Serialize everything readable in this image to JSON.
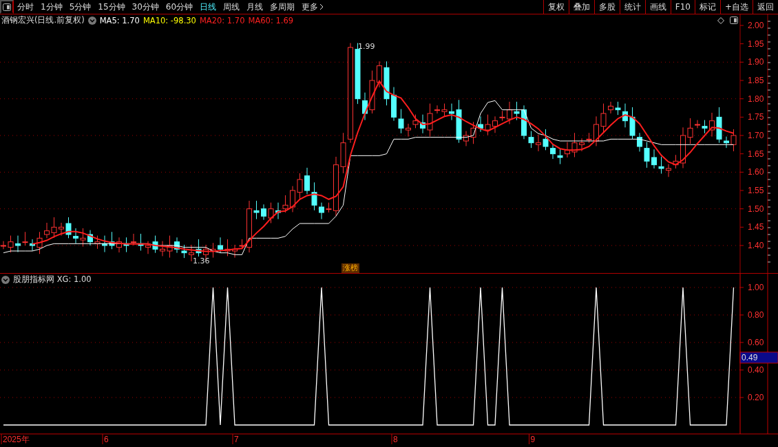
{
  "toolbar": {
    "tabs": [
      {
        "label": "分时",
        "selected": false
      },
      {
        "label": "1分钟",
        "selected": false
      },
      {
        "label": "5分钟",
        "selected": false
      },
      {
        "label": "15分钟",
        "selected": false
      },
      {
        "label": "30分钟",
        "selected": false
      },
      {
        "label": "60分钟",
        "selected": false
      },
      {
        "label": "日线",
        "selected": true
      },
      {
        "label": "周线",
        "selected": false
      },
      {
        "label": "月线",
        "selected": false
      },
      {
        "label": "多周期",
        "selected": false
      },
      {
        "label": "更多",
        "selected": false
      }
    ],
    "actions": [
      "复权",
      "叠加",
      "多股",
      "统计",
      "画线",
      "F10",
      "标记",
      "+自选",
      "返回"
    ]
  },
  "main_panel": {
    "title": "酒钢宏兴(日线.前复权)",
    "indicators": [
      {
        "label": "MA5: 1.70",
        "color": "#ffffff"
      },
      {
        "label": "MA10: -98.30",
        "color": "#ffff00"
      },
      {
        "label": "MA20: 1.70",
        "color": "#ff2020"
      },
      {
        "label": "MA60: 1.69",
        "color": "#ff2020"
      }
    ],
    "price_axis": [
      "2.00",
      "1.95",
      "1.90",
      "1.85",
      "1.80",
      "1.75",
      "1.70",
      "1.65",
      "1.60",
      "1.55",
      "1.50",
      "1.45",
      "1.40"
    ],
    "high_label": "1.99",
    "low_label": "1.36",
    "tag": "涨榜"
  },
  "indicator_panel": {
    "title": "股朋指标网 XG: 1.00",
    "current_reading": "0.49",
    "date_axis": [
      "2025年",
      "6",
      "7",
      "8",
      "9"
    ],
    "chart_data": {
      "type": "line",
      "series": [
        {
          "color": "#ffffff",
          "values": [
            0,
            0,
            0,
            0,
            0,
            0,
            0,
            0,
            0,
            0,
            0,
            0,
            0,
            0,
            0,
            0,
            0,
            0,
            0,
            0,
            0,
            0,
            0,
            0,
            0,
            0,
            0,
            0,
            0,
            1,
            0,
            1,
            0,
            0,
            0,
            0,
            0,
            0,
            0,
            0,
            0,
            0,
            0,
            0,
            1,
            0,
            0,
            0,
            0,
            0,
            0,
            0,
            0,
            0,
            0,
            0,
            0,
            0,
            0,
            1,
            0,
            0,
            0,
            0,
            0,
            0,
            1,
            0,
            0,
            1,
            0,
            0,
            0,
            0,
            0,
            0,
            0,
            0,
            0,
            0,
            0,
            0,
            1,
            0,
            0,
            0,
            0,
            0,
            0,
            0,
            0,
            0,
            0,
            0,
            1,
            0,
            0,
            0,
            0,
            0,
            0,
            1
          ]
        }
      ],
      "ylim": [
        -0.065,
        1.1
      ],
      "grid": true,
      "yticks": [
        {
          "value": 0.2,
          "label": "0.20"
        },
        {
          "value": 0.4,
          "label": "0.40"
        },
        {
          "value": 0.6,
          "label": "0.60"
        },
        {
          "value": 0.8,
          "label": "0.80"
        },
        {
          "value": 1.0,
          "label": "1.00"
        }
      ]
    }
  }
}
